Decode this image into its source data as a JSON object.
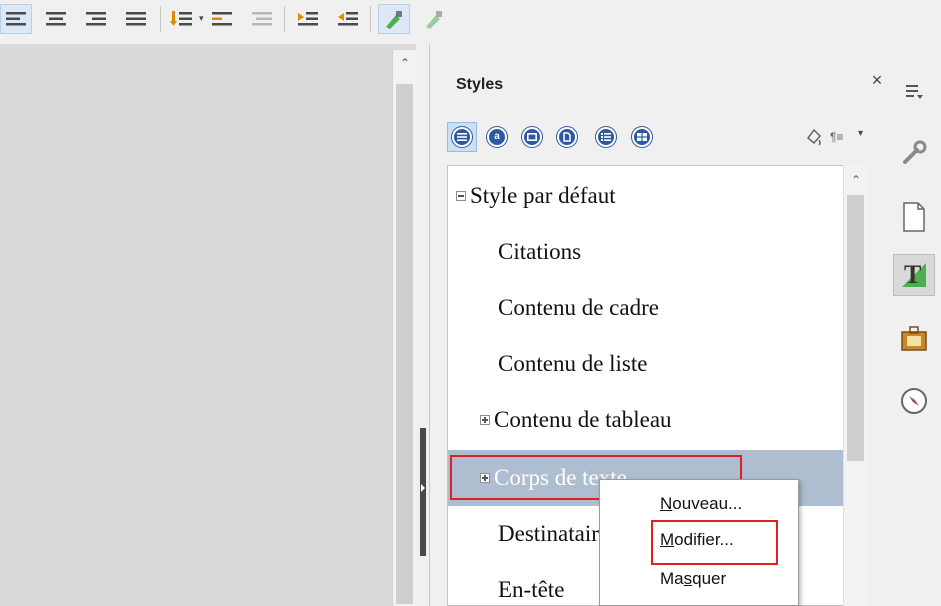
{
  "toolbar": {
    "buttons": [
      "align-left-icon",
      "align-center-icon",
      "align-right-icon",
      "justify-icon",
      "bullet-list-icon",
      "numbered-list-icon",
      "outline-icon",
      "increase-indent-icon",
      "decrease-indent-icon",
      "paint-format-icon",
      "clear-format-icon"
    ]
  },
  "styles_panel": {
    "title": "Styles",
    "close_symbol": "×",
    "families": [
      "paragraph-styles",
      "character-styles",
      "frame-styles",
      "page-styles",
      "list-styles",
      "table-styles"
    ],
    "fill_format_icon": "fill-format-icon",
    "new_style_icon": "new-style-icon",
    "items": [
      {
        "label": "Style par défaut",
        "expander": "minus",
        "indent": 0
      },
      {
        "label": "Citations",
        "expander": "",
        "indent": 1
      },
      {
        "label": "Contenu de cadre",
        "expander": "",
        "indent": 1
      },
      {
        "label": "Contenu de liste",
        "expander": "",
        "indent": 1
      },
      {
        "label": "Contenu de tableau",
        "expander": "plus",
        "indent": 1
      },
      {
        "label": "Corps de texte",
        "expander": "plus",
        "indent": 1,
        "selected": true
      },
      {
        "label": "Destinataire",
        "expander": "",
        "indent": 1
      },
      {
        "label": "En-tête",
        "expander": "",
        "indent": 1
      }
    ]
  },
  "context_menu": {
    "items": [
      {
        "label": "Nouveau...",
        "mnemonic": "N"
      },
      {
        "label": "Modifier...",
        "mnemonic": "M"
      },
      {
        "label": "Masquer",
        "mnemonic": "s"
      }
    ]
  },
  "sidebar_deck": [
    "properties-icon",
    "page-icon",
    "styles-icon",
    "gallery-icon",
    "navigator-icon"
  ],
  "colors": {
    "highlight": "#e02020",
    "selection": "#aebdd0",
    "accent": "#2c5aa0"
  }
}
